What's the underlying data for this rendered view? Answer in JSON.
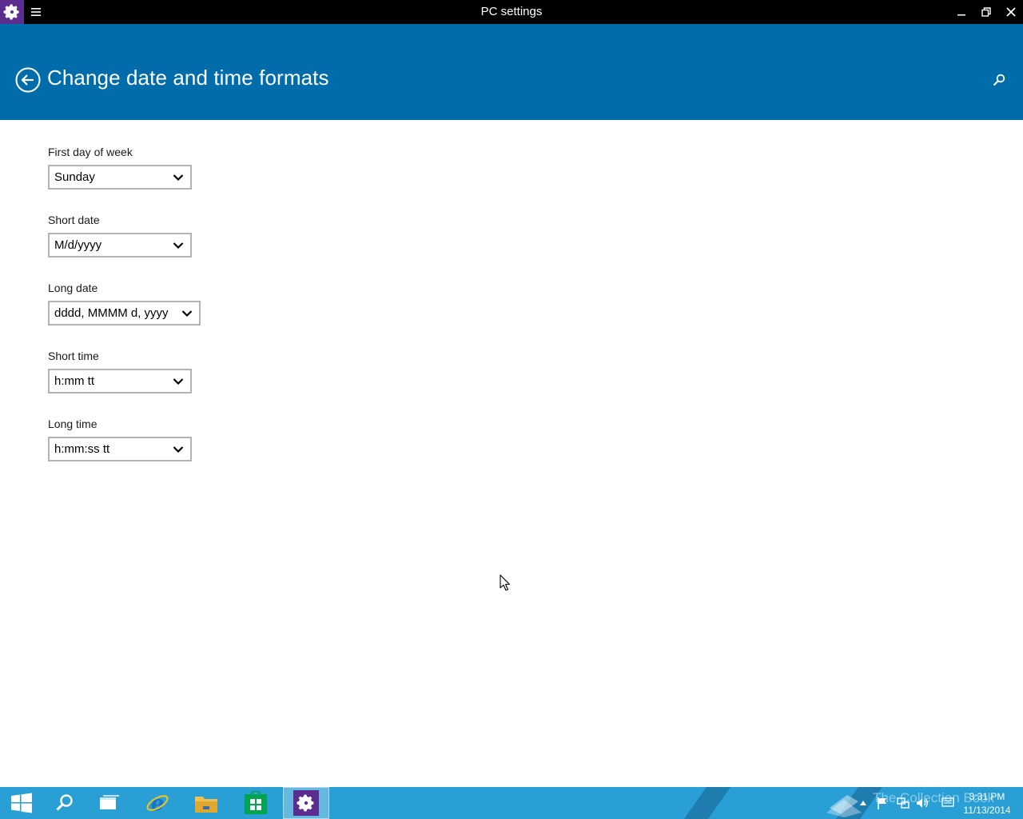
{
  "window": {
    "title": "PC settings"
  },
  "header": {
    "title": "Change date and time formats"
  },
  "form": {
    "first_day_of_week": {
      "label": "First day of week",
      "value": "Sunday"
    },
    "short_date": {
      "label": "Short date",
      "value": "M/d/yyyy"
    },
    "long_date": {
      "label": "Long date",
      "value": "dddd, MMMM d, yyyy"
    },
    "short_time": {
      "label": "Short time",
      "value": "h:mm tt"
    },
    "long_time": {
      "label": "Long time",
      "value": "h:mm:ss tt"
    }
  },
  "taskbar": {
    "watermark": "The Collection Book",
    "clock_time": "3:31 PM",
    "clock_date": "11/13/2014"
  },
  "icons": {
    "app": "gear-icon",
    "menu": "hamburger-icon",
    "back": "back-arrow-icon",
    "search": "search-icon",
    "dropdown": "chevron-down-icon",
    "start": "windows-logo-icon",
    "taskbar_search": "search-icon",
    "task_view": "task-view-icon",
    "browser": "internet-explorer-icon",
    "explorer": "folder-icon",
    "store": "store-icon",
    "settings": "gear-icon"
  },
  "colors": {
    "header": "#006daa",
    "titlebar": "#000000",
    "app_icon": "#5c2d91",
    "taskbar": "#2a9fd6"
  }
}
